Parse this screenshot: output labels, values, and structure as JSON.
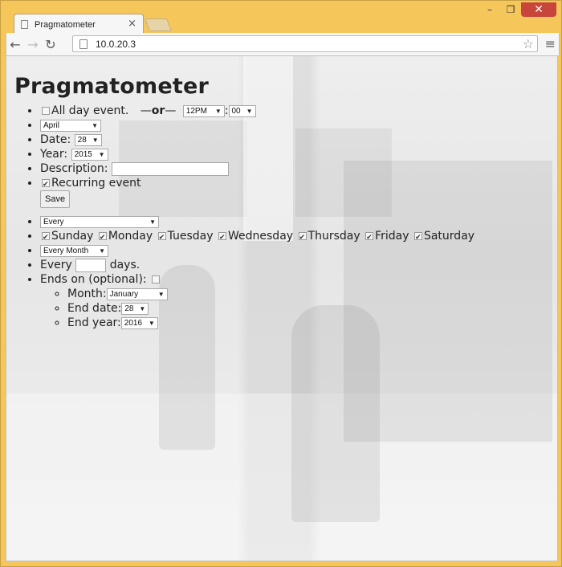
{
  "browser": {
    "tab_title": "Pragmatometer",
    "url": "10.0.20.3"
  },
  "page": {
    "title": "Pragmatometer",
    "all_day_label": "All day event.",
    "or_label": "or",
    "hour_value": "12PM",
    "minute_value": "00",
    "month_value": "April",
    "date_label": "Date:",
    "date_value": "28",
    "year_label": "Year:",
    "year_value": "2015",
    "description_label": "Description:",
    "description_value": "",
    "recurring_label": "Recurring event",
    "save_label": "Save"
  },
  "recurrence": {
    "frequency_value": "Every",
    "days": [
      {
        "label": "Sunday",
        "checked": true
      },
      {
        "label": "Monday",
        "checked": true
      },
      {
        "label": "Tuesday",
        "checked": true
      },
      {
        "label": "Wednesday",
        "checked": true
      },
      {
        "label": "Thursday",
        "checked": true
      },
      {
        "label": "Friday",
        "checked": true
      },
      {
        "label": "Saturday",
        "checked": true
      }
    ],
    "period_value": "Every Month",
    "every_label": "Every",
    "every_value": "",
    "days_label": "days.",
    "ends_on_label": "Ends on (optional):",
    "end_month_label": "Month:",
    "end_month_value": "January",
    "end_date_label": "End date:",
    "end_date_value": "28",
    "end_year_label": "End year:",
    "end_year_value": "2016"
  }
}
